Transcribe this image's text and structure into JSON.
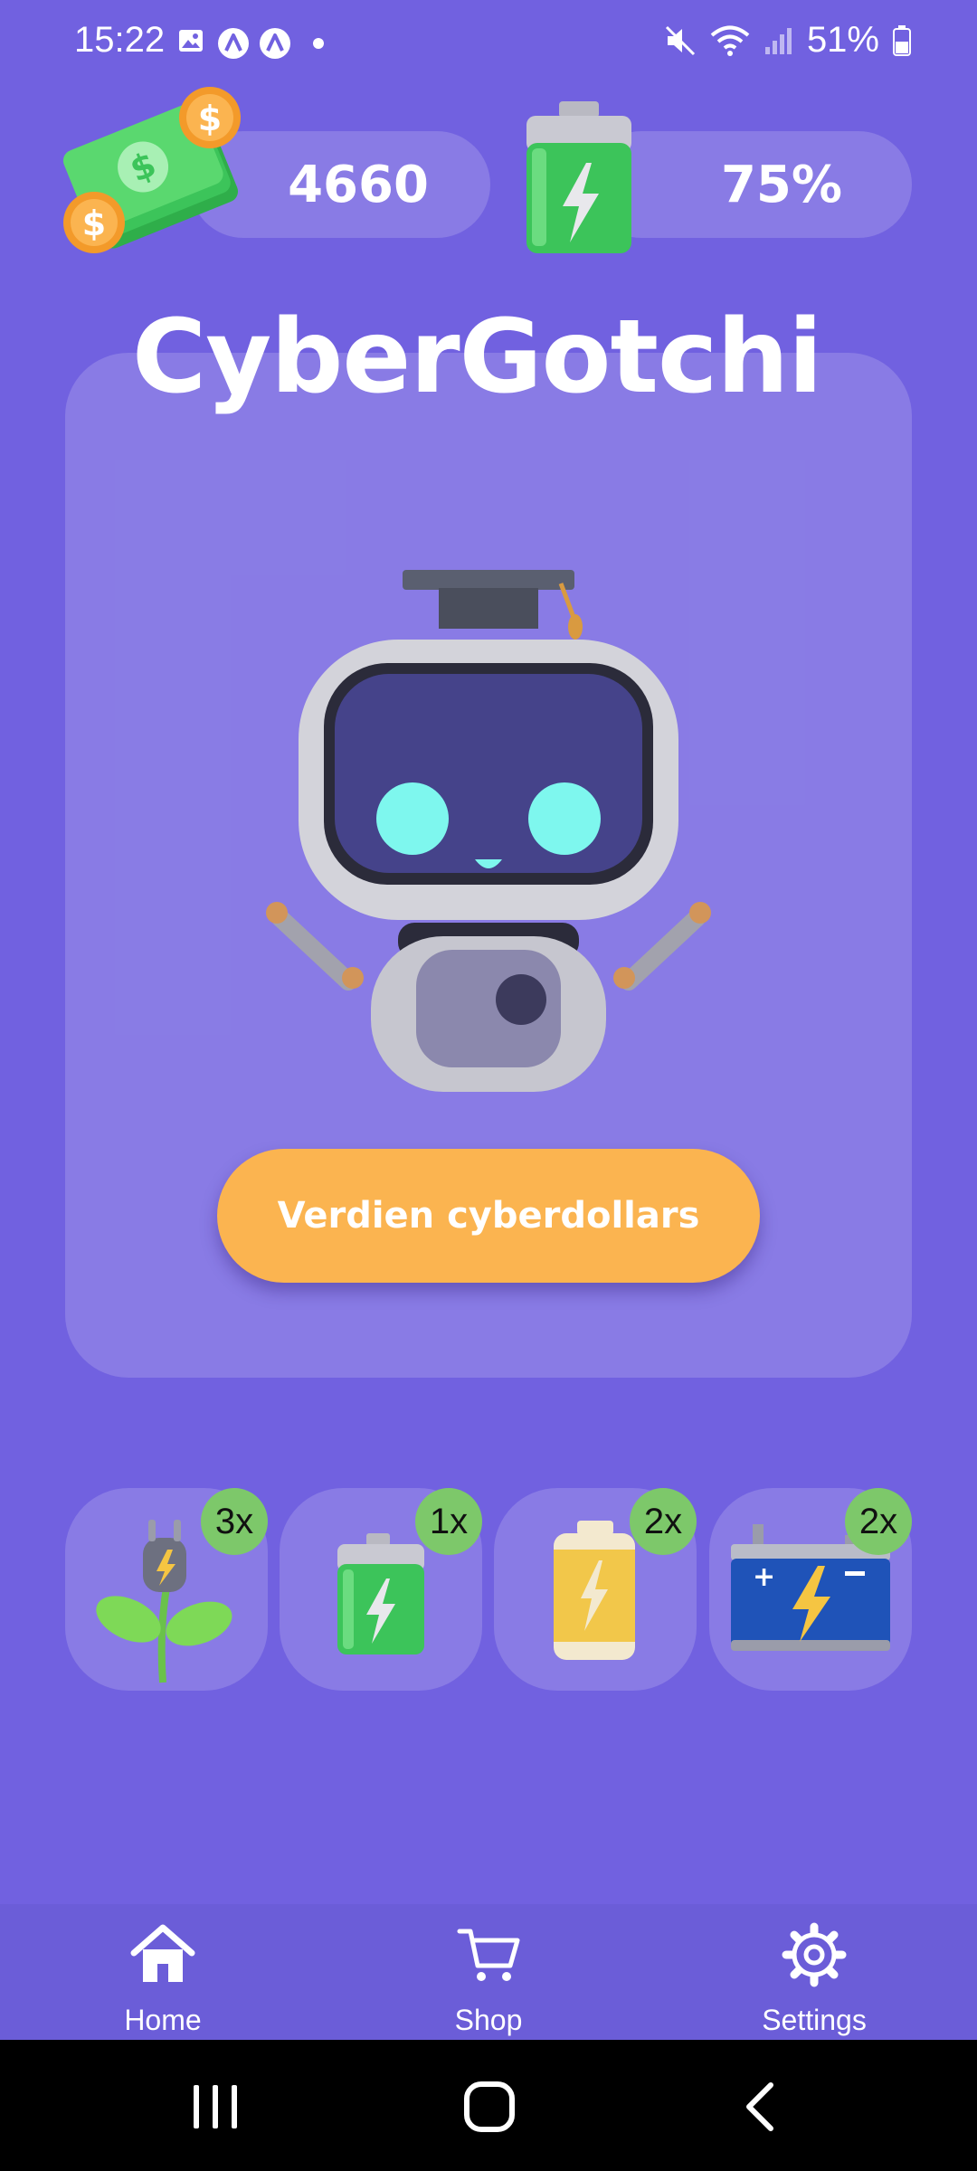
{
  "status_bar": {
    "time": "15:22",
    "left_icons": [
      "image-icon",
      "app-a-icon",
      "app-a-icon",
      "dot-icon"
    ],
    "right_icons": [
      "mute-icon",
      "wifi-icon",
      "signal-icon",
      "battery-icon"
    ],
    "battery_percent": "51%"
  },
  "header": {
    "money_icon": "cash-coins-icon",
    "money_value": "4660",
    "battery_icon": "battery-charge-icon",
    "battery_value": "75%",
    "battery_level": 0.75
  },
  "main": {
    "title": "CyberGotchi",
    "mascot": "robot-graduate-mascot",
    "earn_button_label": "Verdien cyberdollars"
  },
  "inventory": [
    {
      "icon": "plant-plug-icon",
      "count": "3x"
    },
    {
      "icon": "green-battery-icon",
      "count": "1x"
    },
    {
      "icon": "yellow-battery-icon",
      "count": "2x"
    },
    {
      "icon": "car-battery-icon",
      "count": "2x"
    }
  ],
  "nav": {
    "items": [
      {
        "label": "Home",
        "icon": "home-icon"
      },
      {
        "label": "Shop",
        "icon": "cart-icon"
      },
      {
        "label": "Settings",
        "icon": "gear-icon"
      }
    ]
  },
  "system_nav": [
    "recents-icon",
    "home-circle-icon",
    "back-icon"
  ],
  "colors": {
    "background": "#7161e0",
    "card": "rgba(255,255,255,0.17)",
    "button": "#fbb450",
    "badge": "#7dc86a"
  }
}
